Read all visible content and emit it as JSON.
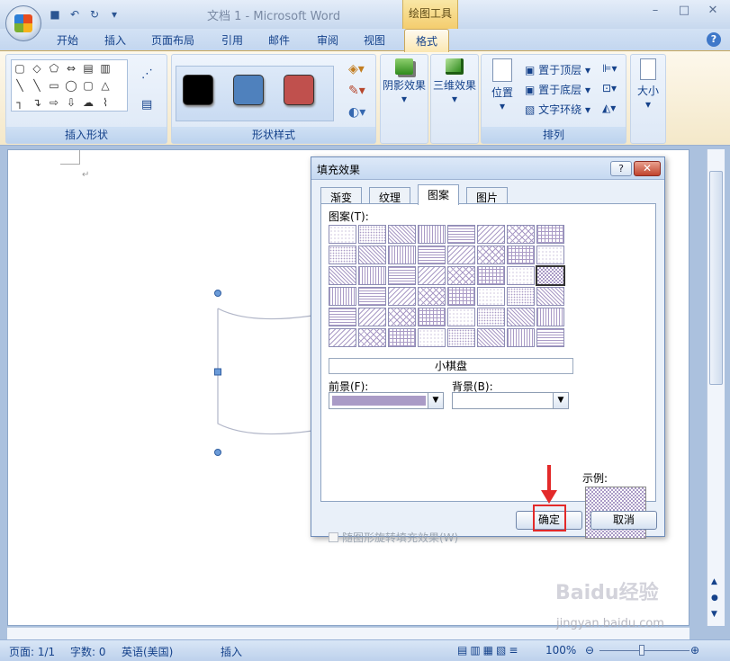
{
  "window": {
    "title": "文档 1 - Microsoft Word",
    "context_tab_header": "绘图工具",
    "minimize": "–",
    "maximize": "□",
    "close": "✕"
  },
  "qat": {
    "save": "■",
    "undo": "↶",
    "redo": "↻",
    "customize": "▾"
  },
  "ribbon_tabs": [
    "开始",
    "插入",
    "页面布局",
    "引用",
    "邮件",
    "审阅",
    "视图",
    "格式"
  ],
  "ribbon_help": "?",
  "ribbon": {
    "insert_shapes": {
      "label": "插入形状",
      "shape_glyphs": [
        "▢",
        "◇",
        "⬠",
        "⇔",
        "▤",
        "▥",
        "",
        "╲",
        "╲",
        "▭",
        "◯",
        "▢",
        "△",
        "",
        "┐",
        "↴",
        "⇨",
        "⇩",
        "☁",
        "⌇",
        ""
      ]
    },
    "shape_styles": {
      "label": "形状样式",
      "swatches": [
        "#000000",
        "#4f81bd",
        "#c0504d"
      ]
    },
    "shadow_effects": {
      "label": "阴影效果"
    },
    "threed_effects": {
      "label": "三维效果"
    },
    "arrange": {
      "label": "排列",
      "position": "位置",
      "bring_to_front": "置于顶层",
      "send_to_back": "置于底层",
      "text_wrap": "文字环绕"
    },
    "size": {
      "label": "大小"
    }
  },
  "dialog": {
    "title": "填充效果",
    "help": "?",
    "close": "✕",
    "tabs": [
      "渐变",
      "纹理",
      "图案",
      "图片"
    ],
    "active_tab": "图案",
    "pattern_label": "图案(T):",
    "selected_pattern_name": "小棋盘",
    "foreground_label": "前景(F):",
    "background_label": "背景(B):",
    "foreground_color": "#aa9bc6",
    "sample_label": "示例:",
    "rotate_checkbox": "随图形旋转填充效果(W)",
    "ok": "确定",
    "cancel": "取消"
  },
  "status": {
    "page": "页面: 1/1",
    "words": "字数: 0",
    "language": "英语(美国)",
    "mode": "插入",
    "zoom": "100%"
  },
  "watermark": {
    "brand": "Baidu经验",
    "url": "jingyan.baidu.com"
  }
}
